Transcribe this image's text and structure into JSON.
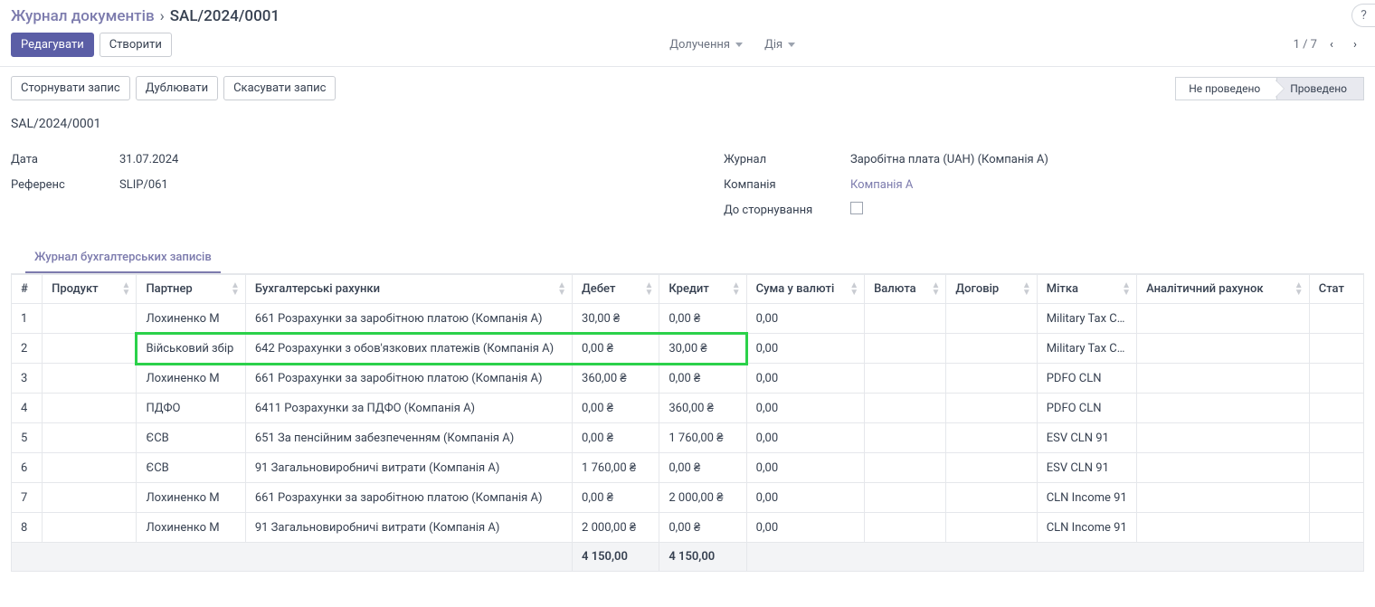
{
  "breadcrumb": {
    "root": "Журнал документів",
    "current": "SAL/2024/0001"
  },
  "actions": {
    "edit": "Редагувати",
    "create": "Створити"
  },
  "center_menus": {
    "attachments": "Долучення",
    "action": "Дія"
  },
  "pager": {
    "text": "1 / 7"
  },
  "secondary": {
    "reverse": "Сторнувати запис",
    "duplicate": "Дублювати",
    "cancel": "Скасувати запис"
  },
  "status": {
    "draft": "Не проведено",
    "posted": "Проведено"
  },
  "doc_number": "SAL/2024/0001",
  "fields": {
    "date_label": "Дата",
    "date_value": "31.07.2024",
    "ref_label": "Референс",
    "ref_value": "SLIP/061",
    "journal_label": "Журнал",
    "journal_value": "Заробітна плата (UAH) (Компанія А)",
    "company_label": "Компанія",
    "company_value": "Компанія А",
    "to_reverse_label": "До сторнування"
  },
  "tab": {
    "label": "Журнал бухгалтерських записів"
  },
  "columns": {
    "num": "#",
    "product": "Продукт",
    "partner": "Партнер",
    "account": "Бухгалтерські рахунки",
    "debit": "Дебет",
    "credit": "Кредит",
    "amount_currency": "Сума у валюті",
    "currency": "Валюта",
    "contract": "Договір",
    "label": "Мітка",
    "analytic": "Аналітичний рахунок",
    "status": "Стат"
  },
  "rows": [
    {
      "n": "1",
      "partner": "Лохиненко М",
      "account": "661 Розрахунки за заробітною платою (Компанія А)",
      "debit": "30,00 ₴",
      "credit": "0,00 ₴",
      "amt": "0,00",
      "label": "Military Tax CLN"
    },
    {
      "n": "2",
      "partner": "Військовий збір",
      "account": "642 Розрахунки з обов'язкових платежів (Компанія А)",
      "debit": "0,00 ₴",
      "credit": "30,00 ₴",
      "amt": "0,00",
      "label": "Military Tax CLN",
      "highlight": true
    },
    {
      "n": "3",
      "partner": "Лохиненко М",
      "account": "661 Розрахунки за заробітною платою (Компанія А)",
      "debit": "360,00 ₴",
      "credit": "0,00 ₴",
      "amt": "0,00",
      "label": "PDFO CLN"
    },
    {
      "n": "4",
      "partner": "ПДФО",
      "account": "6411 Розрахунки за ПДФО (Компанія А)",
      "debit": "0,00 ₴",
      "credit": "360,00 ₴",
      "amt": "0,00",
      "label": "PDFO CLN"
    },
    {
      "n": "5",
      "partner": "ЄСВ",
      "account": "651 За пенсійним забезпеченням (Компанія А)",
      "debit": "0,00 ₴",
      "credit": "1 760,00 ₴",
      "amt": "0,00",
      "label": "ESV CLN 91"
    },
    {
      "n": "6",
      "partner": "ЄСВ",
      "account": "91 Загальновиробничі витрати (Компанія А)",
      "debit": "1 760,00 ₴",
      "credit": "0,00 ₴",
      "amt": "0,00",
      "label": "ESV CLN 91"
    },
    {
      "n": "7",
      "partner": "Лохиненко М",
      "account": "661 Розрахунки за заробітною платою (Компанія А)",
      "debit": "0,00 ₴",
      "credit": "2 000,00 ₴",
      "amt": "0,00",
      "label": "CLN Income 91"
    },
    {
      "n": "8",
      "partner": "Лохиненко М",
      "account": "91 Загальновиробничі витрати (Компанія А)",
      "debit": "2 000,00 ₴",
      "credit": "0,00 ₴",
      "amt": "0,00",
      "label": "CLN Income 91"
    }
  ],
  "totals": {
    "debit": "4 150,00",
    "credit": "4 150,00"
  }
}
